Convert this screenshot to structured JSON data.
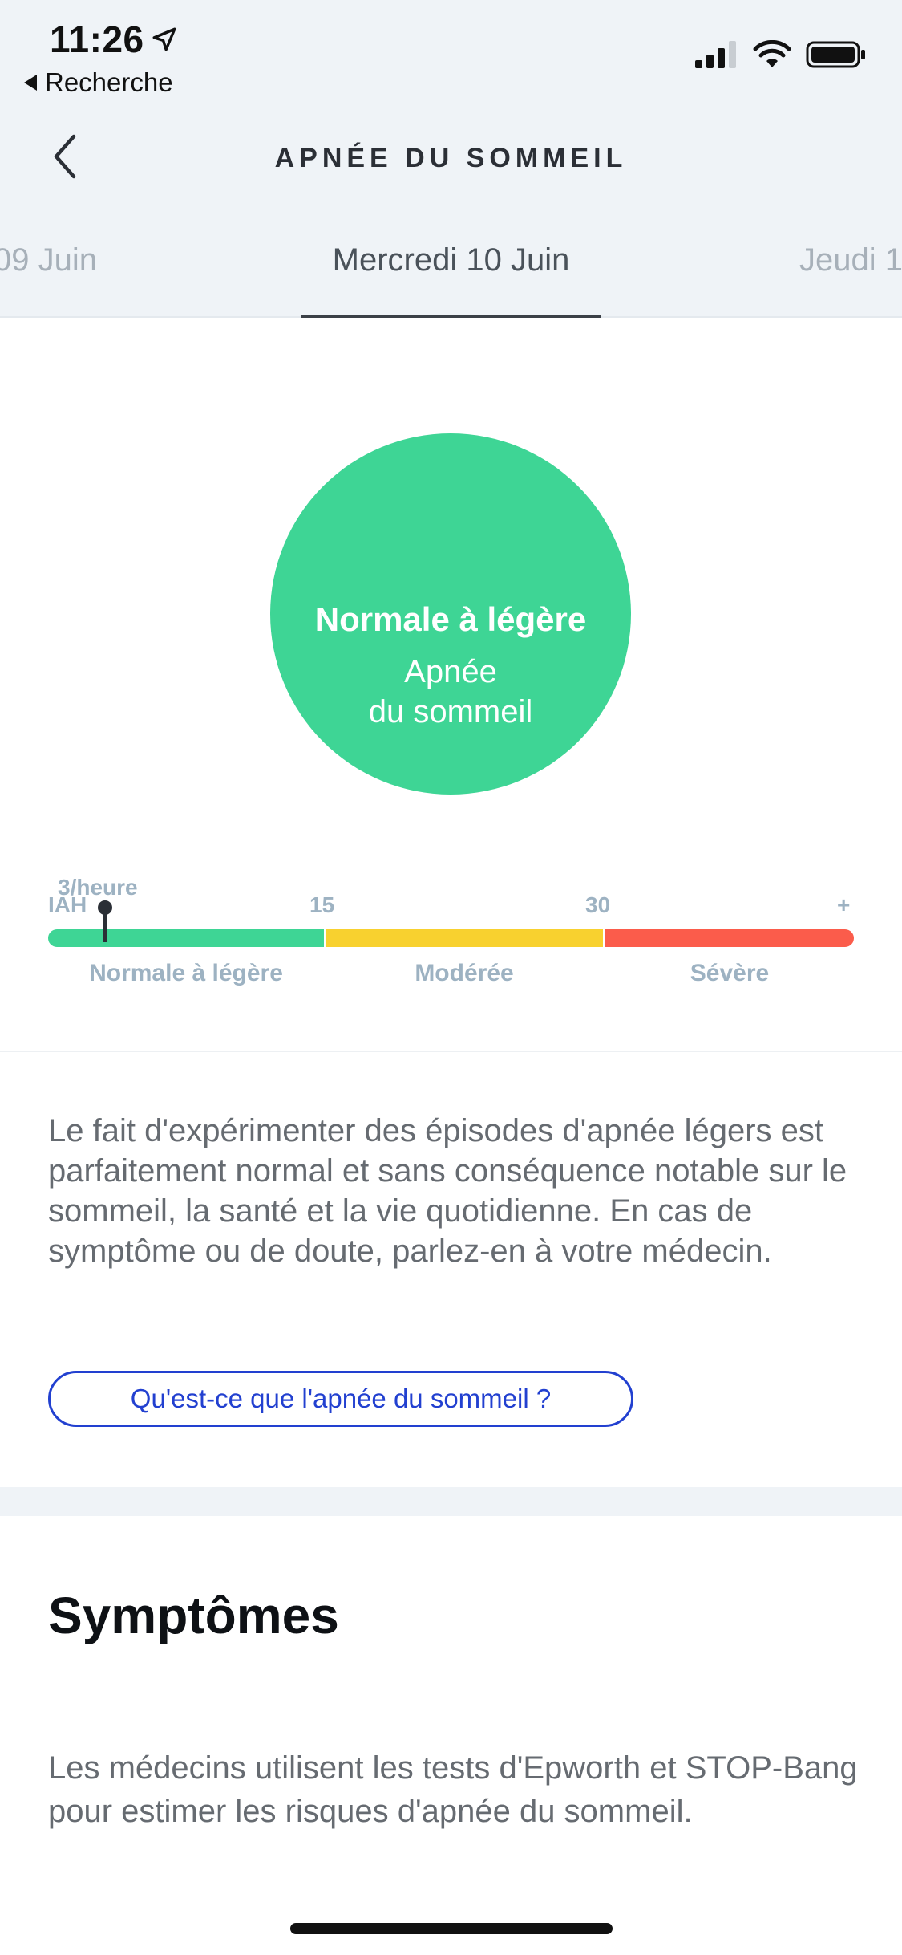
{
  "status_bar": {
    "time": "11:26",
    "back_app_label": "Recherche"
  },
  "header": {
    "title": "APNÉE DU SOMMEIL",
    "tabs": {
      "prev": "09 Juin",
      "current": "Mercredi 10 Juin",
      "next": "Jeudi 1"
    }
  },
  "result": {
    "level": "Normale à légère",
    "subtitle": "Apnée\ndu sommeil"
  },
  "scale": {
    "value_label": "3/heure",
    "value": 3,
    "axis_label": "IAH",
    "ticks": [
      "15",
      "30",
      "+"
    ],
    "categories": [
      "Normale à légère",
      "Modérée",
      "Sévère"
    ],
    "colors": {
      "normal": "#3ed595",
      "moderate": "#f8d12f",
      "severe": "#fb5c4b"
    }
  },
  "description": "Le fait d'expérimenter des épisodes d'apnée légers est parfaitement normal et sans conséquence notable sur le sommeil, la santé et la vie quotidienne. En cas de symptôme ou de doute, parlez-en à votre médecin.",
  "info_button_label": "Qu'est-ce que l'apnée du sommeil ?",
  "symptoms": {
    "title": "Symptômes",
    "text": "Les médecins utilisent les tests d'Epworth et STOP-Bang pour estimer les risques d'apnée du sommeil."
  }
}
